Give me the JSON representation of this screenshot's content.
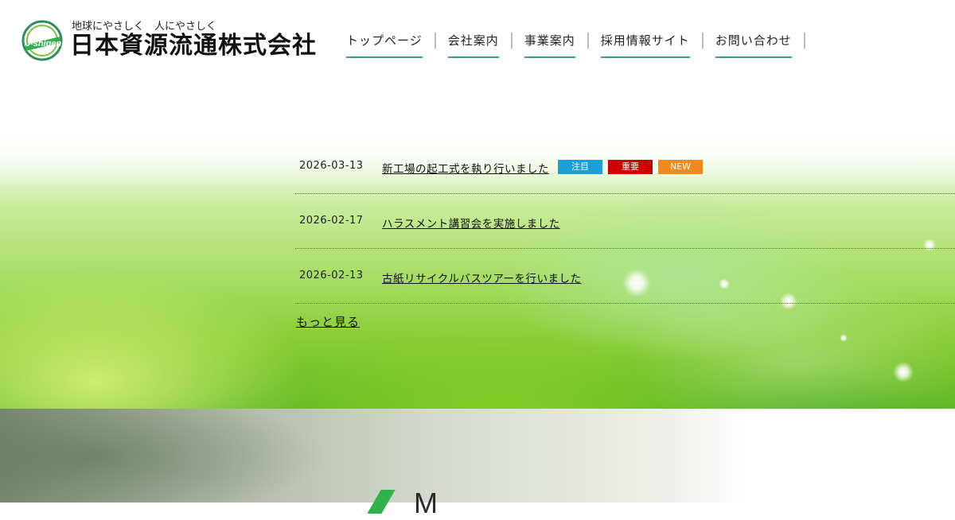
{
  "header": {
    "tagline": "地球にやさしく　人にやさしく",
    "company_name": "日本資源流通株式会社",
    "logo_text": "J-shigen",
    "nav": [
      {
        "label": "トップページ"
      },
      {
        "label": "会社案内"
      },
      {
        "label": "事業案内"
      },
      {
        "label": "採用情報サイト"
      },
      {
        "label": "お問い合わせ"
      }
    ]
  },
  "news": {
    "items": [
      {
        "date": "2026-03-13",
        "title": "新工場の起工式を執り行いました",
        "badges": [
          "注目",
          "重要",
          "NEW"
        ]
      },
      {
        "date": "2026-02-17",
        "title": "ハラスメント講習会を実施しました",
        "badges": []
      },
      {
        "date": "2026-02-13",
        "title": "古紙リサイクルバスツアーを行いました",
        "badges": []
      }
    ],
    "more_label": "もっと見る"
  },
  "badge_colors": {
    "注目": "#1aa0d6",
    "重要": "#cc0000",
    "NEW": "#f08a1c"
  },
  "accent_color": "#3a9a92",
  "section_heading_fragment": "M"
}
